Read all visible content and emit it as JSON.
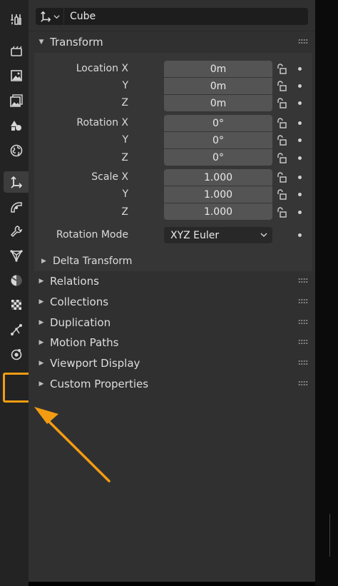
{
  "object": {
    "name": "Cube",
    "type_icon": "object-axes-icon"
  },
  "sidebar": {
    "tabs": [
      {
        "id": "tool",
        "icon": "tool-icon"
      },
      {
        "id": "render",
        "icon": "render-icon"
      },
      {
        "id": "output",
        "icon": "output-icon"
      },
      {
        "id": "view-layer",
        "icon": "view-layer-icon"
      },
      {
        "id": "scene",
        "icon": "scene-icon"
      },
      {
        "id": "world",
        "icon": "world-icon"
      },
      {
        "id": "object",
        "icon": "object-axes-icon",
        "active": true
      },
      {
        "id": "modifiers",
        "icon": "modifier-icon"
      },
      {
        "id": "particles",
        "icon": "wrench-icon"
      },
      {
        "id": "data",
        "icon": "mesh-data-icon"
      },
      {
        "id": "material",
        "icon": "material-sphere-icon"
      },
      {
        "id": "texture",
        "icon": "checker-texture-icon"
      },
      {
        "id": "constraints",
        "icon": "constraint-icon"
      },
      {
        "id": "physics",
        "icon": "physics-icon"
      }
    ]
  },
  "transform": {
    "title": "Transform",
    "location": {
      "label_x": "Location X",
      "label_y": "Y",
      "label_z": "Z",
      "x": "0m",
      "y": "0m",
      "z": "0m"
    },
    "rotation": {
      "label_x": "Rotation X",
      "label_y": "Y",
      "label_z": "Z",
      "x": "0°",
      "y": "0°",
      "z": "0°"
    },
    "scale": {
      "label_x": "Scale X",
      "label_y": "Y",
      "label_z": "Z",
      "x": "1.000",
      "y": "1.000",
      "z": "1.000"
    },
    "rotation_mode": {
      "label": "Rotation Mode",
      "value": "XYZ Euler"
    },
    "delta_title": "Delta Transform"
  },
  "panels": {
    "relations": "Relations",
    "collections": "Collections",
    "duplication": "Duplication",
    "motion_paths": "Motion Paths",
    "viewport_display": "Viewport Display",
    "custom_properties": "Custom Properties"
  },
  "annotation": {
    "highlight_color": "#f39c12"
  },
  "colors": {
    "panel_bg": "#303030",
    "field_bg": "#545454",
    "sidebar_bg": "#232323"
  }
}
